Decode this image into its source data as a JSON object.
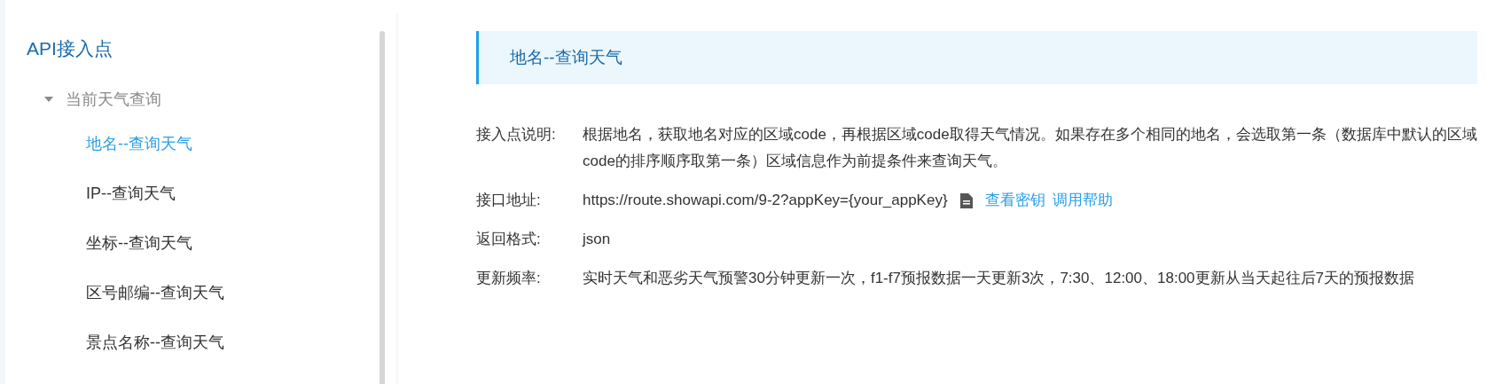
{
  "sidebar": {
    "title": "API接入点",
    "tree": [
      {
        "label": "当前天气查询",
        "expanded": true,
        "children": [
          {
            "label": "地名--查询天气",
            "selected": true
          },
          {
            "label": "IP--查询天气",
            "selected": false
          },
          {
            "label": "坐标--查询天气",
            "selected": false
          },
          {
            "label": "区号邮编--查询天气",
            "selected": false
          },
          {
            "label": "景点名称--查询天气",
            "selected": false
          }
        ]
      }
    ]
  },
  "header": {
    "title": "地名--查询天气"
  },
  "details": [
    {
      "kind": "text",
      "label": "接入点说明:",
      "value": "根据地名，获取地名对应的区域code，再根据区域code取得天气情况。如果存在多个相同的地名，会选取第一条（数据库中默认的区域code的排序顺序取第一条）区域信息作为前提条件来查询天气。"
    },
    {
      "kind": "url",
      "label": "接口地址:",
      "value": "https://route.showapi.com/9-2?appKey={your_appKey}",
      "links": [
        "查看密钥",
        "调用帮助"
      ]
    },
    {
      "kind": "text",
      "label": "返回格式:",
      "value": "json"
    },
    {
      "kind": "text",
      "label": "更新频率:",
      "value": "实时天气和恶劣天气预警30分钟更新一次，f1-f7预报数据一天更新3次，7:30、12:00、18:00更新从当天起往后7天的预报数据"
    }
  ]
}
